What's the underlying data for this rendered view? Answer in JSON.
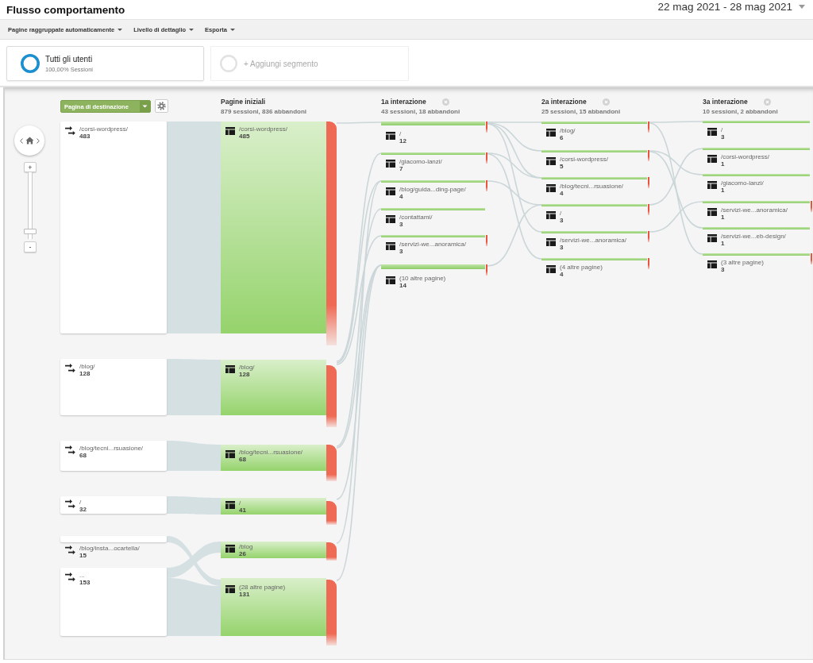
{
  "title": "Flusso comportamento",
  "date_range": {
    "label": "22 mag 2021 - 28 mag 2021"
  },
  "toolbar": [
    {
      "label": "Pagine raggruppate automaticamente"
    },
    {
      "label": "Livello di dettaglio"
    },
    {
      "label": "Esporta"
    }
  ],
  "segments": [
    {
      "kind": "active",
      "name": "Tutti gli utenti",
      "detail": "100,00% Sessioni"
    },
    {
      "kind": "add",
      "name": "+ Aggiungi segmento"
    }
  ],
  "flow": {
    "dimension_menu": {
      "label": "Pagina di destinazione"
    },
    "zoom": {
      "zoom_in": "+",
      "zoom_out": "-",
      "level": 0.08
    },
    "columns": [
      {
        "kind": "landing",
        "nodes": [
          {
            "label": "/corsi-wordpress/",
            "count": "483"
          },
          {
            "label": "/blog/",
            "count": "128"
          },
          {
            "label": "/blog/tecni...rsuasione/",
            "count": "68"
          },
          {
            "label": "/",
            "count": "32"
          },
          {
            "label": "/blog/insta...ocartella/",
            "count": "15"
          },
          {
            "label": "...",
            "count": "153"
          }
        ]
      },
      {
        "kind": "start",
        "title": "Pagine iniziali",
        "summary": "879 sessioni, 836 abbandoni",
        "nodes": [
          {
            "label": "/corsi-wordpress/",
            "count": "485",
            "drop_off": true
          },
          {
            "label": "/blog/",
            "count": "128",
            "drop_off": true
          },
          {
            "label": "/blog/tecni...rsuasione/",
            "count": "68",
            "drop_off": true
          },
          {
            "label": "/",
            "count": "41",
            "drop_off": true
          },
          {
            "label": "/blog",
            "count": "26",
            "drop_off": true
          },
          {
            "label": "(28 altre pagine)",
            "count": "131",
            "drop_off": true
          }
        ]
      },
      {
        "kind": "interaction",
        "title": "1a interazione",
        "summary": "43 sessioni, 18 abbandoni",
        "nodes": [
          {
            "label": "/",
            "count": "12",
            "drop_off": true
          },
          {
            "label": "/giacomo-lanzi/",
            "count": "7",
            "drop_off": true
          },
          {
            "label": "/blog/guida...ding-page/",
            "count": "4",
            "drop_off": true
          },
          {
            "label": "/contattami/",
            "count": "3",
            "drop_off": false
          },
          {
            "label": "/servizi-we...anoramica/",
            "count": "3",
            "drop_off": true
          },
          {
            "label": "(10 altre pagine)",
            "count": "14",
            "drop_off": true
          }
        ]
      },
      {
        "kind": "interaction",
        "title": "2a interazione",
        "summary": "25 sessioni, 15 abbandoni",
        "nodes": [
          {
            "label": "/blog/",
            "count": "6",
            "drop_off": true
          },
          {
            "label": "/corsi-wordpress/",
            "count": "5",
            "drop_off": true
          },
          {
            "label": "/blog/tecni...rsuasione/",
            "count": "4",
            "drop_off": true
          },
          {
            "label": "/",
            "count": "3",
            "drop_off": true
          },
          {
            "label": "/servizi-we...anoramica/",
            "count": "3",
            "drop_off": true
          },
          {
            "label": "(4 altre pagine)",
            "count": "4",
            "drop_off": true
          }
        ]
      },
      {
        "kind": "interaction",
        "title": "3a interazione",
        "summary": "10 sessioni, 2 abbandoni",
        "nodes": [
          {
            "label": "/",
            "count": "3",
            "drop_off": false
          },
          {
            "label": "/corsi-wordpress/",
            "count": "1",
            "drop_off": false
          },
          {
            "label": "/giacomo-lanzi/",
            "count": "1",
            "drop_off": false
          },
          {
            "label": "/servizi-we...anoramica/",
            "count": "1",
            "drop_off": true
          },
          {
            "label": "/servizi-we...eb-design/",
            "count": "1",
            "drop_off": false
          },
          {
            "label": "(3 altre pagine)",
            "count": "3",
            "drop_off": true
          }
        ]
      }
    ]
  }
}
